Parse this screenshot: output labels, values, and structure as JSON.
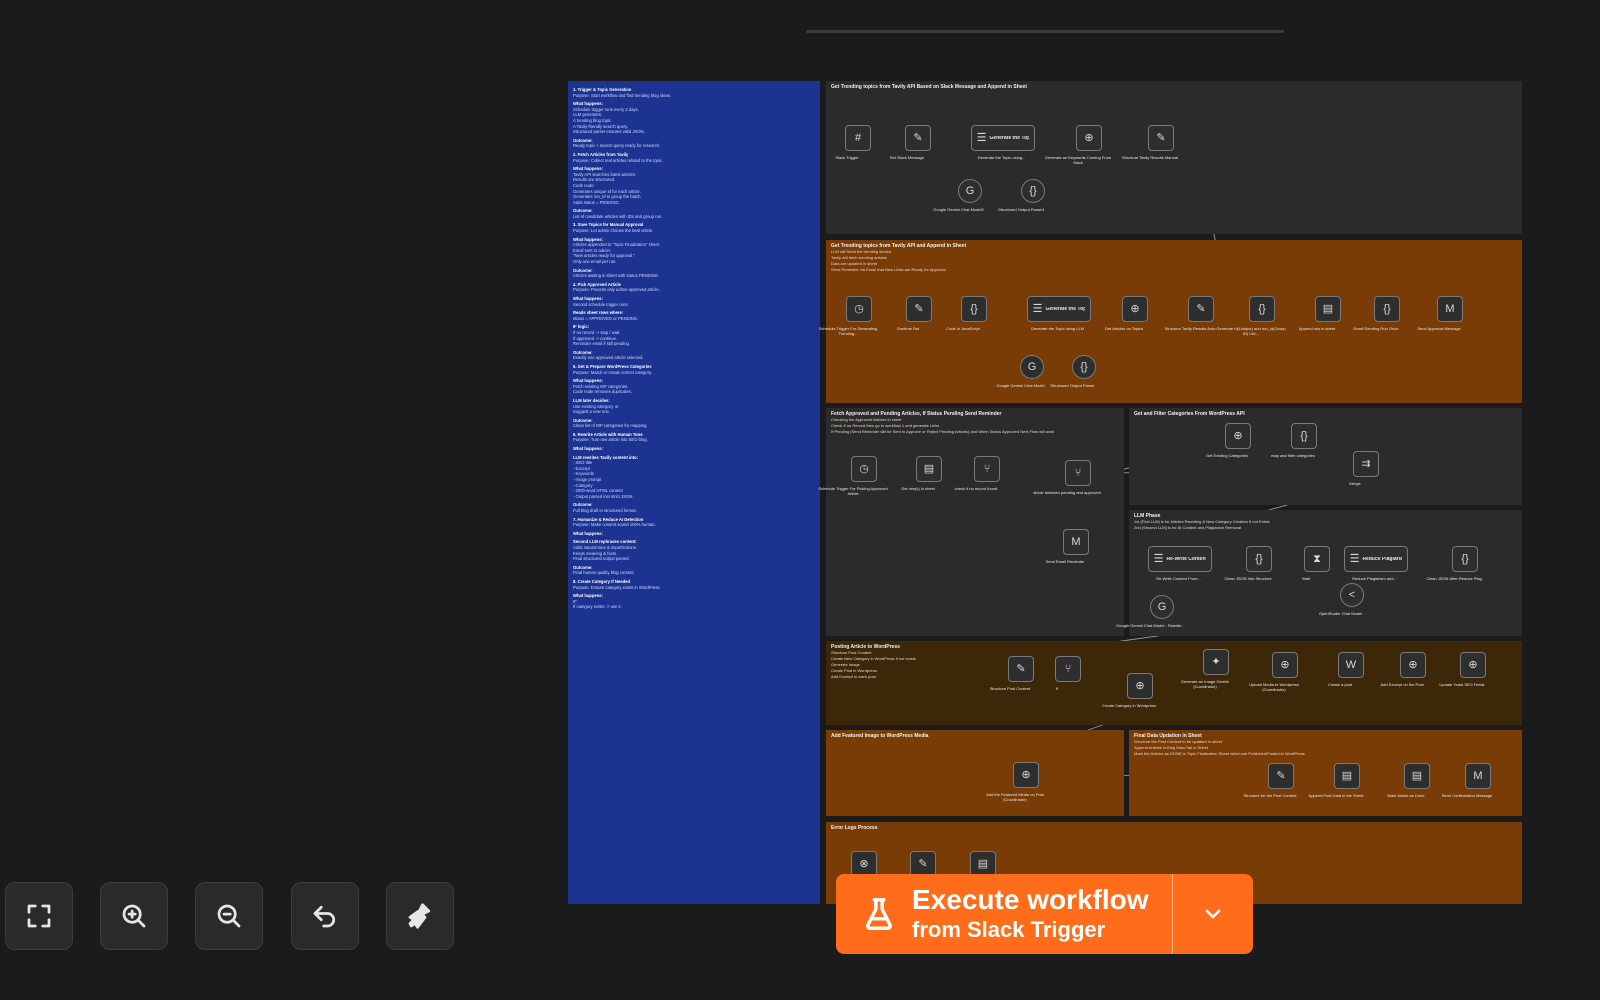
{
  "colors": {
    "canvas": "#1b1b1b",
    "accent": "#ff6d1a",
    "notes_bg": "#1d3391",
    "sticky_orange": "#7a3c06",
    "sticky_gray": "#2b2b2b",
    "sticky_brown": "#3d2709"
  },
  "notes": {
    "lines": [
      {
        "t": "1. Trigger & Topic Generation",
        "h": true
      },
      {
        "t": "Purpose: Start workflow and find trending blog ideas."
      },
      {
        "t": "What happens:",
        "h": true
      },
      {
        "t": "Schedule trigger runs every 2 days."
      },
      {
        "t": "LLM generates:"
      },
      {
        "t": "A trending blog topic."
      },
      {
        "t": "A Tavily-friendly search query."
      },
      {
        "t": "Structured parser ensures valid JSON."
      },
      {
        "t": "Outcome:",
        "h": true
      },
      {
        "t": "Ready topic + search query ready for research."
      },
      {
        "t": "2. Fetch Articles from Tavily",
        "h": true
      },
      {
        "t": "Purpose: Collect real articles related to the topic."
      },
      {
        "t": "What happens:",
        "h": true
      },
      {
        "t": "Tavily API searches latest articles."
      },
      {
        "t": "Results are structured."
      },
      {
        "t": "Code node:"
      },
      {
        "t": "Generates unique Id for each article."
      },
      {
        "t": "Generates run_Id to group the batch."
      },
      {
        "t": "Adds status = PENDING."
      },
      {
        "t": "Outcome:",
        "h": true
      },
      {
        "t": "List of candidate articles with IDs and group run."
      },
      {
        "t": "3. Save Topics for Manual Approval",
        "h": true
      },
      {
        "t": "Purpose: Let admin choose the best article."
      },
      {
        "t": "What happens:",
        "h": true
      },
      {
        "t": "Articles appended to \"Topic Finalization\" sheet."
      },
      {
        "t": "Email sent to admin:"
      },
      {
        "t": "\"New articles ready for approval.\""
      },
      {
        "t": "Only one email per run."
      },
      {
        "t": "Outcome:",
        "h": true
      },
      {
        "t": "Articles waiting in sheet with status PENDING."
      },
      {
        "t": "4. Pick Approved Article",
        "h": true
      },
      {
        "t": "Purpose: Process only admin-approved article."
      },
      {
        "t": "What happens:",
        "h": true
      },
      {
        "t": "Second schedule trigger runs."
      },
      {
        "t": "Reads sheet rows where:",
        "h": true
      },
      {
        "t": "status = APPROVED or PENDING."
      },
      {
        "t": "IF logic:",
        "h": true
      },
      {
        "t": "If no record -> stop / wait."
      },
      {
        "t": "If approved -> continue."
      },
      {
        "t": "Reminder email if still pending."
      },
      {
        "t": "Outcome:",
        "h": true
      },
      {
        "t": "Exactly one approved article selected."
      },
      {
        "t": "5. Get & Prepare WordPress Categories",
        "h": true
      },
      {
        "t": "Purpose: Match or create correct category."
      },
      {
        "t": "What happens:",
        "h": true
      },
      {
        "t": "Fetch existing WP categories."
      },
      {
        "t": "Code node removes duplicates."
      },
      {
        "t": "LLM later decides:",
        "h": true
      },
      {
        "t": "Use existing category, or"
      },
      {
        "t": "Suggest a new one."
      },
      {
        "t": "Outcome:",
        "h": true
      },
      {
        "t": "Clean list of WP categories for mapping."
      },
      {
        "t": "6. Rewrite Article with Human Tone",
        "h": true
      },
      {
        "t": "Purpose: Turn raw article into SEO blog."
      },
      {
        "t": "What happens:",
        "h": true
      },
      {
        "t": "LLM rewrites Tavily content into:",
        "h": true
      },
      {
        "t": "- SEO title"
      },
      {
        "t": "- Excerpt"
      },
      {
        "t": "- Keywords"
      },
      {
        "t": "- Image prompt"
      },
      {
        "t": "- Category"
      },
      {
        "t": "- 2000-word HTML content"
      },
      {
        "t": "- Output parsed into strict JSON."
      },
      {
        "t": "Outcome:",
        "h": true
      },
      {
        "t": "Full blog draft in structured format."
      },
      {
        "t": "7. Humanize & Reduce AI Detection",
        "h": true
      },
      {
        "t": "Purpose: Make content sound 100% human."
      },
      {
        "t": "What happens:",
        "h": true
      },
      {
        "t": "Second LLM rephrases content:",
        "h": true
      },
      {
        "t": "Adds natural tone & imperfections."
      },
      {
        "t": "Keeps meaning & facts."
      },
      {
        "t": "Final structured output parsed."
      },
      {
        "t": "Outcome:",
        "h": true
      },
      {
        "t": "Final human-quality blog content."
      },
      {
        "t": "8. Create Category If Needed",
        "h": true
      },
      {
        "t": "Purpose: Ensure category exists in WordPress."
      },
      {
        "t": "What happens:",
        "h": true
      },
      {
        "t": "IF:"
      },
      {
        "t": "If category exists -> use it."
      }
    ]
  },
  "stickies": [
    {
      "id": "s1",
      "title": "Get Trending topics from Tavily API Based on Slack Message and Append in Sheet",
      "desc": []
    },
    {
      "id": "s2",
      "title": "Get Trending topics from Tavily API and Append in Sheet",
      "desc": [
        "LLM will Send the trending stories",
        "Tavily will fetch trending articles",
        "Data are updated in sheet",
        "Send Reminder via Email that New Links are Ready for Approval"
      ]
    },
    {
      "id": "s3",
      "title": "Fetch Approved and Pending Articles, If Status Pending Send Reminder",
      "desc": [
        "Checking the Approved Articles in sheet",
        "Check If no Record then go to workflow 1 and generate Links",
        "If Pending (Send Reminder will be Sent to Approve or Reject Pending Articles) and When Status Approved Next Flow will work"
      ]
    },
    {
      "id": "s4",
      "title": "Get and Filter Categories From WordPress API",
      "desc": []
    },
    {
      "id": "s5",
      "title": "LLM Phase",
      "desc": [
        "1st (First LLM) is for Articles Rewriting & New Category Creation If not Exists",
        "2nd (Second LLM) is for AI Content and Plagiarism Removal"
      ]
    },
    {
      "id": "s6",
      "title": "Posting Article to WordPress",
      "desc": [
        "Structure Post Content",
        "Create New Category in WordPress If not exists",
        "Generate Image",
        "Create Post in Wordpress",
        "Add Excerpt to each post"
      ]
    },
    {
      "id": "s7",
      "title": "Add Featured Image to WordPress Media",
      "desc": []
    },
    {
      "id": "s8",
      "title": "Final Data Updation in Sheet",
      "desc": [
        "Structure the Post Content to be updated in sheet",
        "Append Articles in Blog Data Tab in Sheet",
        "Mark the Articles as DONE in Topic Finalization Sheet which are Published/Posted in WordPress"
      ]
    },
    {
      "id": "s9",
      "title": "Error Logs Process",
      "desc": []
    }
  ],
  "nodes": [
    {
      "id": "n1",
      "label": "Slack Trigger",
      "icon": "slack-icon",
      "glyph": "#"
    },
    {
      "id": "n2",
      "label": "Set Slack Message",
      "icon": "edit-icon",
      "glyph": "✎"
    },
    {
      "id": "n3",
      "label": "Generate the Topic using...",
      "icon": "agent-icon",
      "glyph": "☰"
    },
    {
      "id": "n4",
      "label": "Generate an Keywords Coming From Slack",
      "icon": "globe-icon",
      "glyph": "⊕"
    },
    {
      "id": "n5",
      "label": "Structure Tavily Results Manual",
      "icon": "edit-icon",
      "glyph": "✎"
    },
    {
      "id": "n6",
      "label": "Google Gemini Chat Model2",
      "icon": "gemini-icon",
      "glyph": "G"
    },
    {
      "id": "n7",
      "label": "Structured Output Parser1",
      "icon": "parser-icon",
      "glyph": "{}"
    },
    {
      "id": "n8",
      "label": "Schedule Trigger For Generating Trending...",
      "icon": "clock-icon",
      "glyph": "◷"
    },
    {
      "id": "n9",
      "label": "Runtime Set",
      "icon": "edit-icon",
      "glyph": "✎"
    },
    {
      "id": "n10",
      "label": "Code in JavaScript",
      "icon": "code-icon",
      "glyph": "{}"
    },
    {
      "id": "n11",
      "label": "Generate the Topic using LLM",
      "icon": "agent-icon",
      "glyph": "☰"
    },
    {
      "id": "n12",
      "label": "Get Articles on Topics",
      "icon": "globe-icon",
      "glyph": "⊕"
    },
    {
      "id": "n13",
      "label": "Structure Tavily Results Auto",
      "icon": "edit-icon",
      "glyph": "✎"
    },
    {
      "id": "n14",
      "label": "Generate Id(Unique) and run_Id(Group ID) Life...",
      "icon": "code-icon",
      "glyph": "{}"
    },
    {
      "id": "n15",
      "label": "Append row in sheet",
      "icon": "sheets-icon",
      "glyph": "▤"
    },
    {
      "id": "n16",
      "label": "Email Sending Run Once",
      "icon": "code-icon",
      "glyph": "{}"
    },
    {
      "id": "n17",
      "label": "Send Approval Message",
      "icon": "gmail-icon",
      "glyph": "M"
    },
    {
      "id": "n18",
      "label": "Google Gemini Chat Model",
      "icon": "gemini-icon",
      "glyph": "G"
    },
    {
      "id": "n19",
      "label": "Structured Output Parser",
      "icon": "parser-icon",
      "glyph": "{}"
    },
    {
      "id": "n20",
      "label": "Schedule Trigger For Picking Approved Article",
      "icon": "clock-icon",
      "glyph": "◷"
    },
    {
      "id": "n21",
      "label": "Get row(s) in sheet",
      "icon": "sheets-icon",
      "glyph": "▤"
    },
    {
      "id": "n22",
      "label": "check if no record found",
      "icon": "if-icon",
      "glyph": "⑂"
    },
    {
      "id": "n23",
      "label": "divide between pending and approved",
      "icon": "if-icon",
      "glyph": "⑂"
    },
    {
      "id": "n24",
      "label": "Send Email Reminder",
      "icon": "gmail-icon",
      "glyph": "M"
    },
    {
      "id": "n25",
      "label": "Get Existing Categories",
      "icon": "globe-icon",
      "glyph": "⊕"
    },
    {
      "id": "n26",
      "label": "map and filter categories",
      "icon": "code-icon",
      "glyph": "{}"
    },
    {
      "id": "n27",
      "label": "Merge",
      "icon": "merge-icon",
      "glyph": "⇉"
    },
    {
      "id": "n28",
      "label": "Re-Write Content From...",
      "icon": "agent-icon",
      "glyph": "☰"
    },
    {
      "id": "n29",
      "label": "Clean JSON Into Structure",
      "icon": "code-icon",
      "glyph": "{}"
    },
    {
      "id": "n30",
      "label": "Wait",
      "icon": "wait-icon",
      "glyph": "⧗"
    },
    {
      "id": "n31",
      "label": "Reduce Plagiarism and...",
      "icon": "agent-icon",
      "glyph": "☰"
    },
    {
      "id": "n32",
      "label": "Clean JSON After Reduce Plag",
      "icon": "code-icon",
      "glyph": "{}"
    },
    {
      "id": "n33",
      "label": "Google Gemini Chat Model - Rewrite...",
      "icon": "gemini-icon",
      "glyph": "G"
    },
    {
      "id": "n34",
      "label": "OpenRouter Chat Model",
      "icon": "openrouter-icon",
      "glyph": "<"
    },
    {
      "id": "n35",
      "label": "Structure Post Content",
      "icon": "edit-icon",
      "glyph": "✎"
    },
    {
      "id": "n36",
      "label": "If",
      "icon": "if-icon",
      "glyph": "⑂"
    },
    {
      "id": "n37",
      "label": "Create Category in Wordpress",
      "icon": "globe-icon",
      "glyph": "⊕"
    },
    {
      "id": "n38",
      "label": "Generate an Image Gemini (Coordinator)",
      "icon": "gemini-icon",
      "glyph": "✦"
    },
    {
      "id": "n39",
      "label": "Upload Media to Wordpress (Coordinator)",
      "icon": "globe-icon",
      "glyph": "⊕"
    },
    {
      "id": "n40",
      "label": "Create a post",
      "icon": "wordpress-icon",
      "glyph": "W"
    },
    {
      "id": "n41",
      "label": "Add Excerpt on the Post",
      "icon": "globe-icon",
      "glyph": "⊕"
    },
    {
      "id": "n42",
      "label": "Update Yoast SEO Fields",
      "icon": "globe-icon",
      "glyph": "⊕"
    },
    {
      "id": "n43",
      "label": "Add the Featured Media on Post (Coordinator)",
      "icon": "globe-icon",
      "glyph": "⊕"
    },
    {
      "id": "n44",
      "label": "Structure for the Post Content",
      "icon": "edit-icon",
      "glyph": "✎"
    },
    {
      "id": "n45",
      "label": "Append Post Data in the Sheet",
      "icon": "sheets-icon",
      "glyph": "▤"
    },
    {
      "id": "n46",
      "label": "Mark Article as Done",
      "icon": "sheets-icon",
      "glyph": "▤"
    },
    {
      "id": "n47",
      "label": "Send Confirmation Message",
      "icon": "gmail-icon",
      "glyph": "M"
    },
    {
      "id": "n48",
      "label": "",
      "icon": "error-trigger-icon",
      "glyph": "⊗"
    },
    {
      "id": "n49",
      "label": "",
      "icon": "edit-icon",
      "glyph": "✎"
    },
    {
      "id": "n50",
      "label": "",
      "icon": "sheets-icon",
      "glyph": "▤"
    }
  ],
  "controls": {
    "fit": "fit-view-icon",
    "zoom_in": "zoom-in-icon",
    "zoom_out": "zoom-out-icon",
    "undo": "undo-icon",
    "tidy": "tidy-up-icon"
  },
  "execute": {
    "title": "Execute workflow",
    "subtitle": "from Slack Trigger"
  }
}
